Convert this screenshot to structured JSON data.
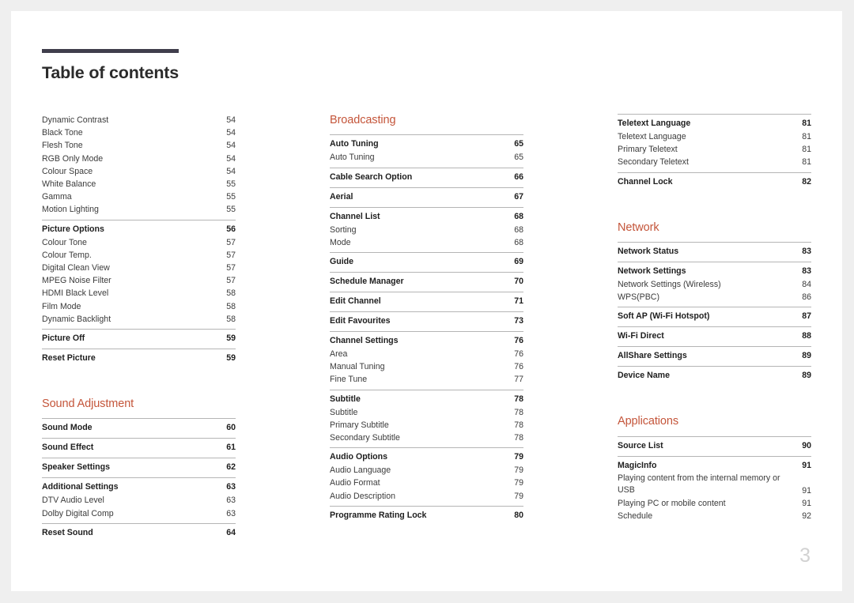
{
  "document": {
    "title": "Table of contents",
    "page_number": "3",
    "accent_color": "#c4553a",
    "rule_color": "#403e4c"
  },
  "columns": [
    {
      "name": "column-1",
      "blocks": [
        {
          "type": "plain-list",
          "items": [
            {
              "label": "Dynamic Contrast",
              "page": "54",
              "level": "sub"
            },
            {
              "label": "Black Tone",
              "page": "54",
              "level": "sub"
            },
            {
              "label": "Flesh Tone",
              "page": "54",
              "level": "sub"
            },
            {
              "label": "RGB Only Mode",
              "page": "54",
              "level": "sub"
            },
            {
              "label": "Colour Space",
              "page": "54",
              "level": "sub"
            },
            {
              "label": "White Balance",
              "page": "55",
              "level": "sub"
            },
            {
              "label": "Gamma",
              "page": "55",
              "level": "sub"
            },
            {
              "label": "Motion Lighting",
              "page": "55",
              "level": "sub"
            }
          ]
        },
        {
          "type": "group",
          "items": [
            {
              "label": "Picture Options",
              "page": "56",
              "level": "main"
            },
            {
              "label": "Colour Tone",
              "page": "57",
              "level": "sub"
            },
            {
              "label": "Colour Temp.",
              "page": "57",
              "level": "sub"
            },
            {
              "label": "Digital Clean View",
              "page": "57",
              "level": "sub"
            },
            {
              "label": "MPEG Noise Filter",
              "page": "57",
              "level": "sub"
            },
            {
              "label": "HDMI Black Level",
              "page": "58",
              "level": "sub"
            },
            {
              "label": "Film Mode",
              "page": "58",
              "level": "sub"
            },
            {
              "label": "Dynamic Backlight",
              "page": "58",
              "level": "sub"
            }
          ]
        },
        {
          "type": "group",
          "items": [
            {
              "label": "Picture Off",
              "page": "59",
              "level": "main"
            }
          ]
        },
        {
          "type": "group",
          "items": [
            {
              "label": "Reset Picture",
              "page": "59",
              "level": "main"
            }
          ]
        },
        {
          "type": "heading",
          "heading": "Sound Adjustment",
          "spaced": true
        },
        {
          "type": "group",
          "items": [
            {
              "label": "Sound Mode",
              "page": "60",
              "level": "main"
            }
          ]
        },
        {
          "type": "group",
          "items": [
            {
              "label": "Sound Effect",
              "page": "61",
              "level": "main"
            }
          ]
        },
        {
          "type": "group",
          "items": [
            {
              "label": "Speaker Settings",
              "page": "62",
              "level": "main"
            }
          ]
        },
        {
          "type": "group",
          "items": [
            {
              "label": "Additional Settings",
              "page": "63",
              "level": "main"
            },
            {
              "label": "DTV Audio Level",
              "page": "63",
              "level": "sub"
            },
            {
              "label": "Dolby Digital Comp",
              "page": "63",
              "level": "sub"
            }
          ]
        },
        {
          "type": "group",
          "items": [
            {
              "label": "Reset Sound",
              "page": "64",
              "level": "main"
            }
          ]
        }
      ]
    },
    {
      "name": "column-2",
      "blocks": [
        {
          "type": "heading",
          "heading": "Broadcasting",
          "spaced": false
        },
        {
          "type": "group",
          "items": [
            {
              "label": "Auto Tuning",
              "page": "65",
              "level": "main"
            },
            {
              "label": "Auto Tuning",
              "page": "65",
              "level": "sub"
            }
          ]
        },
        {
          "type": "group",
          "items": [
            {
              "label": "Cable Search Option",
              "page": "66",
              "level": "main"
            }
          ]
        },
        {
          "type": "group",
          "items": [
            {
              "label": "Aerial",
              "page": "67",
              "level": "main"
            }
          ]
        },
        {
          "type": "group",
          "items": [
            {
              "label": "Channel List",
              "page": "68",
              "level": "main"
            },
            {
              "label": "Sorting",
              "page": "68",
              "level": "sub"
            },
            {
              "label": "Mode",
              "page": "68",
              "level": "sub"
            }
          ]
        },
        {
          "type": "group",
          "items": [
            {
              "label": "Guide",
              "page": "69",
              "level": "main"
            }
          ]
        },
        {
          "type": "group",
          "items": [
            {
              "label": "Schedule Manager",
              "page": "70",
              "level": "main"
            }
          ]
        },
        {
          "type": "group",
          "items": [
            {
              "label": "Edit Channel",
              "page": "71",
              "level": "main"
            }
          ]
        },
        {
          "type": "group",
          "items": [
            {
              "label": "Edit Favourites",
              "page": "73",
              "level": "main"
            }
          ]
        },
        {
          "type": "group",
          "items": [
            {
              "label": "Channel Settings",
              "page": "76",
              "level": "main"
            },
            {
              "label": "Area",
              "page": "76",
              "level": "sub"
            },
            {
              "label": "Manual Tuning",
              "page": "76",
              "level": "sub"
            },
            {
              "label": "Fine Tune",
              "page": "77",
              "level": "sub"
            }
          ]
        },
        {
          "type": "group",
          "items": [
            {
              "label": "Subtitle",
              "page": "78",
              "level": "main"
            },
            {
              "label": "Subtitle",
              "page": "78",
              "level": "sub"
            },
            {
              "label": "Primary Subtitle",
              "page": "78",
              "level": "sub"
            },
            {
              "label": "Secondary Subtitle",
              "page": "78",
              "level": "sub"
            }
          ]
        },
        {
          "type": "group",
          "items": [
            {
              "label": "Audio Options",
              "page": "79",
              "level": "main"
            },
            {
              "label": "Audio Language",
              "page": "79",
              "level": "sub"
            },
            {
              "label": "Audio Format",
              "page": "79",
              "level": "sub"
            },
            {
              "label": "Audio Description",
              "page": "79",
              "level": "sub"
            }
          ]
        },
        {
          "type": "group",
          "items": [
            {
              "label": "Programme Rating Lock",
              "page": "80",
              "level": "main"
            }
          ]
        }
      ]
    },
    {
      "name": "column-3",
      "blocks": [
        {
          "type": "group",
          "items": [
            {
              "label": "Teletext Language",
              "page": "81",
              "level": "main"
            },
            {
              "label": "Teletext Language",
              "page": "81",
              "level": "sub"
            },
            {
              "label": "Primary Teletext",
              "page": "81",
              "level": "sub"
            },
            {
              "label": "Secondary Teletext",
              "page": "81",
              "level": "sub"
            }
          ]
        },
        {
          "type": "group",
          "items": [
            {
              "label": "Channel Lock",
              "page": "82",
              "level": "main"
            }
          ]
        },
        {
          "type": "heading",
          "heading": "Network",
          "spaced": true
        },
        {
          "type": "group",
          "items": [
            {
              "label": "Network Status",
              "page": "83",
              "level": "main"
            }
          ]
        },
        {
          "type": "group",
          "items": [
            {
              "label": "Network Settings",
              "page": "83",
              "level": "main"
            },
            {
              "label": "Network Settings (Wireless)",
              "page": "84",
              "level": "sub"
            },
            {
              "label": "WPS(PBC)",
              "page": "86",
              "level": "sub"
            }
          ]
        },
        {
          "type": "group",
          "items": [
            {
              "label": "Soft AP (Wi-Fi Hotspot)",
              "page": "87",
              "level": "main"
            }
          ]
        },
        {
          "type": "group",
          "items": [
            {
              "label": "Wi-Fi Direct",
              "page": "88",
              "level": "main"
            }
          ]
        },
        {
          "type": "group",
          "items": [
            {
              "label": "AllShare Settings",
              "page": "89",
              "level": "main"
            }
          ]
        },
        {
          "type": "group",
          "items": [
            {
              "label": "Device Name",
              "page": "89",
              "level": "main"
            }
          ]
        },
        {
          "type": "heading",
          "heading": "Applications",
          "spaced": true
        },
        {
          "type": "group",
          "items": [
            {
              "label": "Source List",
              "page": "90",
              "level": "main"
            }
          ]
        },
        {
          "type": "group",
          "items": [
            {
              "label": "MagicInfo",
              "page": "91",
              "level": "main"
            },
            {
              "label": "Playing content from the internal memory or USB",
              "page": "91",
              "level": "sub",
              "wrap": true
            },
            {
              "label": "Playing PC or mobile content",
              "page": "91",
              "level": "sub"
            },
            {
              "label": "Schedule",
              "page": "92",
              "level": "sub"
            }
          ]
        }
      ]
    }
  ]
}
